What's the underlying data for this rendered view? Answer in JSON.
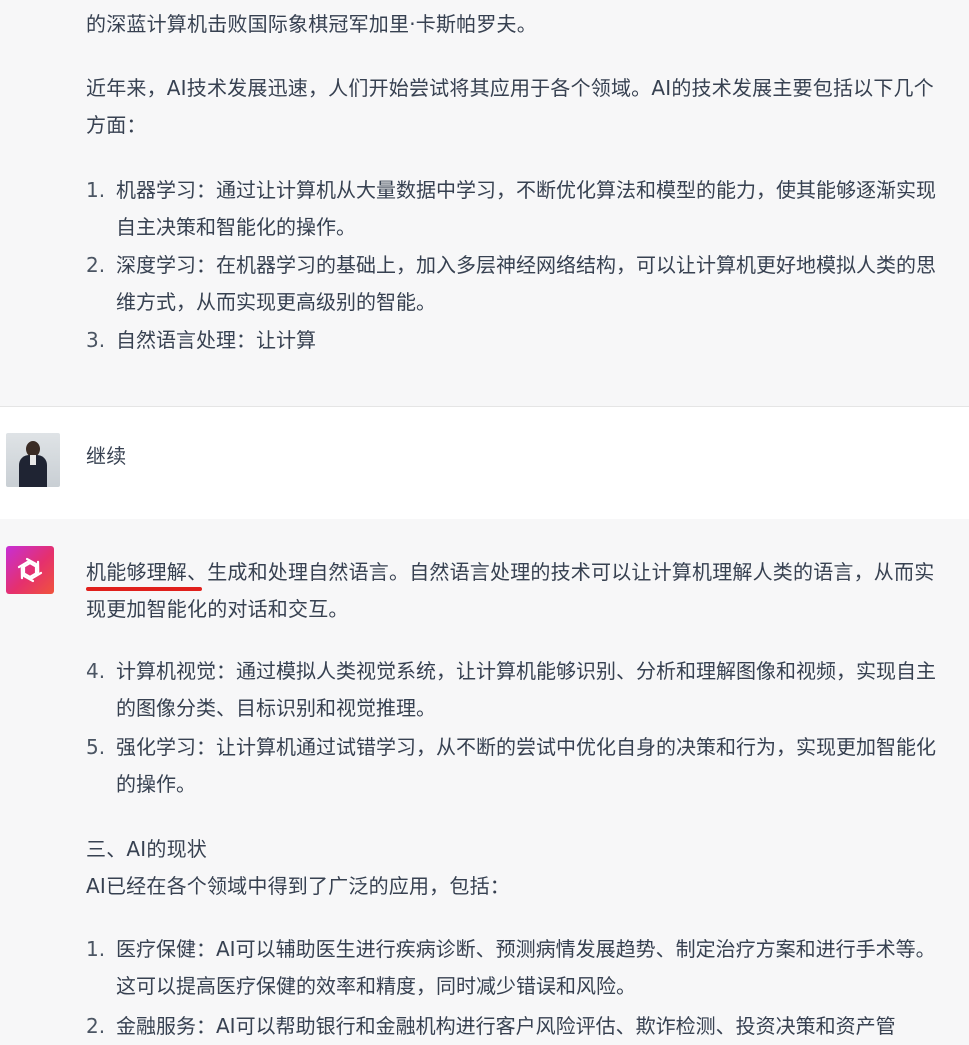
{
  "top_response": {
    "line_intro": "的深蓝计算机击败国际象棋冠军加里·卡斯帕罗夫。",
    "paragraph": "近年来，AI技术发展迅速，人们开始尝试将其应用于各个领域。AI的技术发展主要包括以下几个方面：",
    "list": [
      {
        "num": "1.",
        "text": "机器学习：通过让计算机从大量数据中学习，不断优化算法和模型的能力，使其能够逐渐实现自主决策和智能化的操作。"
      },
      {
        "num": "2.",
        "text": "深度学习：在机器学习的基础上，加入多层神经网络结构，可以让计算机更好地模拟人类的思维方式，从而实现更高级别的智能。"
      },
      {
        "num": "3.",
        "text": "自然语言处理：让计算"
      }
    ]
  },
  "user_message": {
    "avatar_icon": "user-photo-avatar",
    "text": "继续"
  },
  "continued_response": {
    "avatar_icon": "openai-logo-icon",
    "avatar_colors": [
      "#c62fd6",
      "#e5306d",
      "#f0533c"
    ],
    "highlight_color": "#e0201c",
    "paragraph": "机能够理解、生成和处理自然语言。自然语言处理的技术可以让计算机理解人类的语言，从而实现更加智能化的对话和交互。",
    "list_a": [
      {
        "num": "4.",
        "text": "计算机视觉：通过模拟人类视觉系统，让计算机能够识别、分析和理解图像和视频，实现自主的图像分类、目标识别和视觉推理。"
      },
      {
        "num": "5.",
        "text": "强化学习：让计算机通过试错学习，从不断的尝试中优化自身的决策和行为，实现更加智能化的操作。"
      }
    ],
    "heading": "三、AI的现状",
    "heading_sub": "AI已经在各个领域中得到了广泛的应用，包括：",
    "list_b": [
      {
        "num": "1.",
        "text": "医疗保健：AI可以辅助医生进行疾病诊断、预测病情发展趋势、制定治疗方案和进行手术等。这可以提高医疗保健的效率和精度，同时减少错误和风险。"
      },
      {
        "num": "2.",
        "text": "金融服务：AI可以帮助银行和金融机构进行客户风险评估、欺诈检测、投资决策和资产管"
      }
    ]
  }
}
